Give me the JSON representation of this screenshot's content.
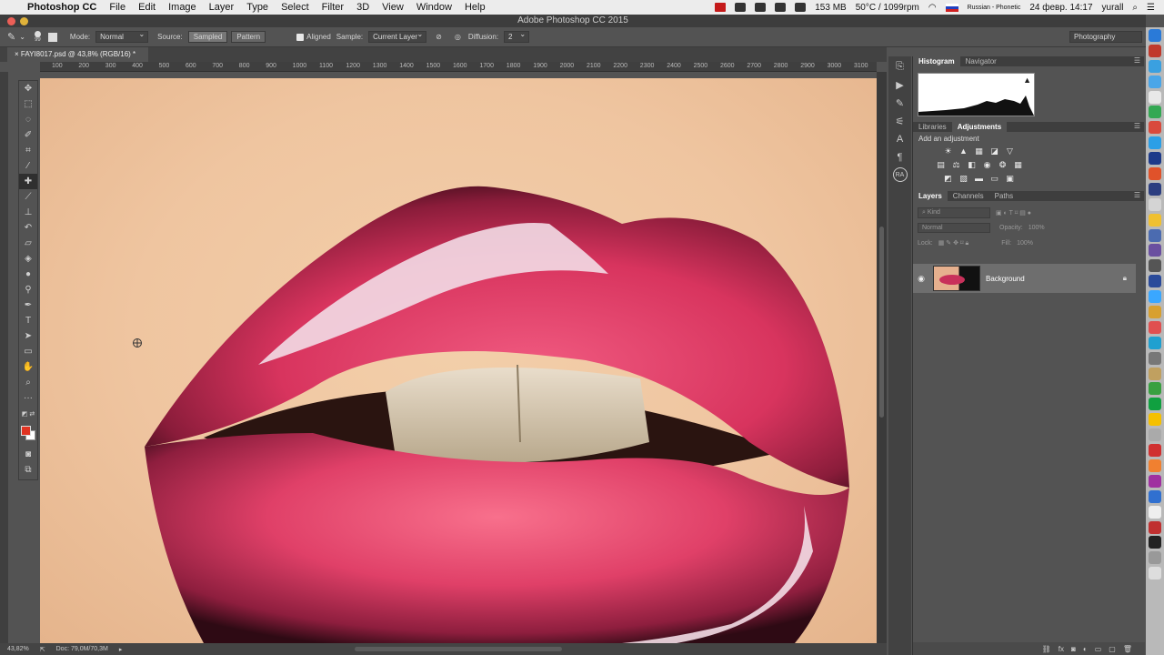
{
  "menubar": {
    "app_name": "Photoshop CC",
    "items": [
      "File",
      "Edit",
      "Image",
      "Layer",
      "Type",
      "Select",
      "Filter",
      "3D",
      "View",
      "Window",
      "Help"
    ],
    "memory": "153 MB",
    "temp": "50°C / 1099rpm",
    "keyboard": "Russian - Phonetic",
    "datetime": "24 февр. 14:17",
    "user": "yurall"
  },
  "window": {
    "title": "Adobe Photoshop CC 2015"
  },
  "options": {
    "brush_size": "99",
    "mode_label": "Mode:",
    "mode_value": "Normal",
    "source_label": "Source:",
    "source_sampled": "Sampled",
    "source_pattern": "Pattern",
    "aligned_label": "Aligned",
    "sample_label": "Sample:",
    "sample_value": "Current Layer",
    "diffusion_label": "Diffusion:",
    "diffusion_value": "2",
    "workspace": "Photography"
  },
  "document": {
    "tab_title": "FAYI8017.psd @ 43,8% (RGB/16) *",
    "ruler_ticks": [
      "100",
      "200",
      "300",
      "400",
      "500",
      "600",
      "700",
      "800",
      "900",
      "1000",
      "1100",
      "1200",
      "1300",
      "1400",
      "1500",
      "1600",
      "1700",
      "1800",
      "1900",
      "2000",
      "2100",
      "2200",
      "2300",
      "2400",
      "2500",
      "2600",
      "2700",
      "2800",
      "2900",
      "3000",
      "3100"
    ]
  },
  "statusbar": {
    "zoom": "43,82%",
    "doc": "Doc: 79,0M/70,3M"
  },
  "panels": {
    "histogram_tab": "Histogram",
    "navigator_tab": "Navigator",
    "libraries_tab": "Libraries",
    "adjustments_tab": "Adjustments",
    "add_adjustment": "Add an adjustment",
    "layers_tab": "Layers",
    "channels_tab": "Channels",
    "paths_tab": "Paths",
    "kind_placeholder": "Kind",
    "blend_mode": "Normal",
    "opacity_label": "Opacity:",
    "opacity_value": "100%",
    "lock_label": "Lock:",
    "fill_label": "Fill:",
    "fill_value": "100%",
    "layer_name": "Background"
  },
  "colors": {
    "foreground": "#e03322",
    "background": "#ffffff"
  }
}
